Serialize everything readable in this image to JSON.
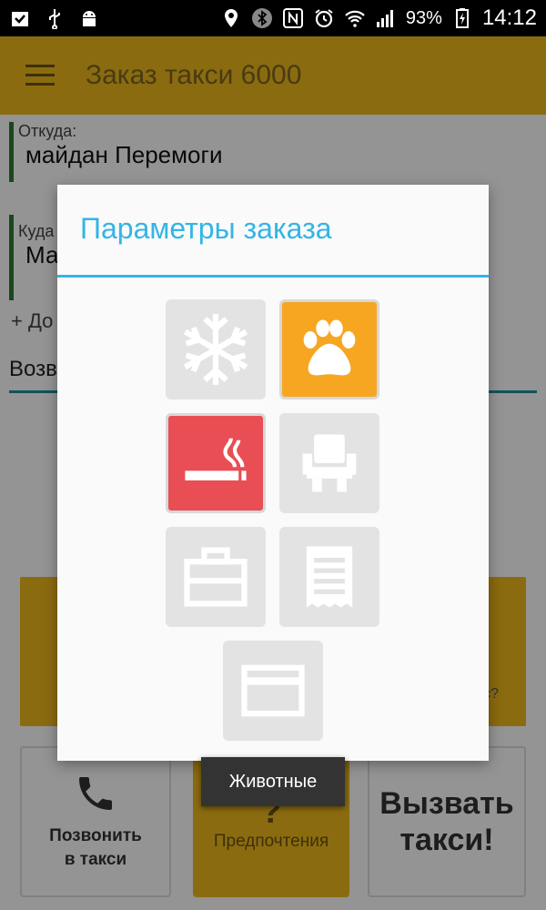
{
  "status_bar": {
    "battery_percent": "93%",
    "time": "14:12",
    "left_icons": [
      "check-clipboard-icon",
      "usb-icon",
      "android-icon"
    ],
    "right_icons": [
      "location-icon",
      "bluetooth-icon",
      "nfc-icon",
      "alarm-icon",
      "wifi-icon",
      "signal-icon",
      "battery-charging-icon"
    ]
  },
  "app_bar": {
    "title": "Заказ такси 6000",
    "menu_icon": "hamburger-icon"
  },
  "form": {
    "from_label": "Откуда:",
    "from_value": "майдан Перемоги",
    "to_label": "Куда",
    "to_value": "Ма",
    "add_stop": "+ До",
    "return_field": "Возв",
    "card_hint": "с?"
  },
  "bottom_buttons": {
    "call_label_line1": "Позвонить",
    "call_label_line2": "в такси",
    "prefs_icon": "?",
    "prefs_label": "Предпочтения",
    "order_line1": "Вызвать",
    "order_line2": "такси!"
  },
  "dialog": {
    "title": "Параметры заказа",
    "options": [
      {
        "name": "air-conditioning",
        "icon": "snowflake-icon",
        "selected": false
      },
      {
        "name": "pets",
        "icon": "paw-icon",
        "selected": true,
        "color": "#f7a622"
      },
      {
        "name": "smoking",
        "icon": "smoking-icon",
        "selected": true,
        "color": "#e84e54"
      },
      {
        "name": "child-seat",
        "icon": "seat-icon",
        "selected": false
      },
      {
        "name": "luggage",
        "icon": "briefcase-icon",
        "selected": false
      },
      {
        "name": "receipt",
        "icon": "receipt-icon",
        "selected": false
      },
      {
        "name": "card-payment",
        "icon": "credit-card-icon",
        "selected": false
      }
    ]
  },
  "toast": {
    "text": "Животные"
  },
  "colors": {
    "accent_yellow": "#f0b81c",
    "dialog_blue": "#33b5e5",
    "pets_orange": "#f7a622",
    "smoking_red": "#e84e54",
    "inactive_tile": "#e3e3e3"
  }
}
